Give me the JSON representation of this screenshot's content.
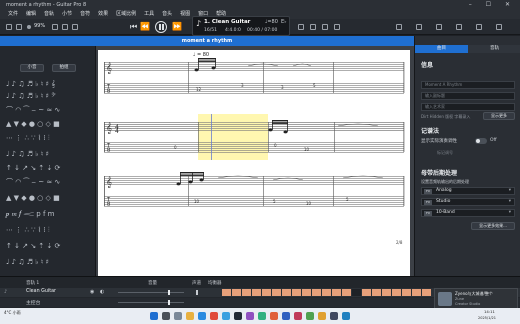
{
  "window": {
    "title": "moment a rhythm - Guitar Pro 8",
    "controls": "– ☐ ✕"
  },
  "menu": [
    "文件",
    "编辑",
    "音轨",
    "小节",
    "音符",
    "效果",
    "区域比例",
    "工具",
    "音头",
    "视图",
    "窗口",
    "帮助"
  ],
  "toolbar": {
    "zoom": "99%",
    "page_btn_left": "页视",
    "page_btn_right": "单视"
  },
  "lcd": {
    "track_name": "1. Clean Guitar",
    "position": "16/51",
    "signature": "4:4.0:0",
    "time": "00:40 / 07:00",
    "tempo": "♩=80",
    "key": "E♭"
  },
  "doc_tab": "moment a rhythm",
  "score": {
    "tempo_mark": "♩ = 80",
    "page_number": "2/8"
  },
  "right_panel": {
    "tabs": [
      "曲目",
      "音轨"
    ],
    "info_heading": "信息",
    "title_placeholder": "Moment A Rhythm",
    "subtitle_placeholder": "输入副标题",
    "artist_placeholder": "输入艺术家",
    "more_btn": "显示更多",
    "copyright_text": "Dirt Hidden    版权 字幕录入",
    "notation_heading": "记谱法",
    "notation_label": "显示实际演奏调性",
    "toggle_label": "Off",
    "notation_sub": "标记调号",
    "master_heading": "母带后期处理",
    "master_desc": "设置音频轨输出的后期处理",
    "effects": [
      {
        "tag": "FX",
        "name": "Analog"
      },
      {
        "tag": "FX",
        "name": "Studio"
      },
      {
        "tag": "FX",
        "name": "10-Band"
      }
    ],
    "show_more_effects": "显示更多效果..."
  },
  "left_panel": {
    "tab1": "小音",
    "tab2": "拍组"
  },
  "tracks": {
    "header_label": "音轨 1",
    "volume_label": "音量",
    "pan_label": "声道",
    "eq_label": "均衡器",
    "items": [
      {
        "name": "Clean Guitar"
      },
      {
        "name": "主控台"
      }
    ]
  },
  "notification": {
    "title": "Zyeno与大城谱/整个",
    "line2": "Zune",
    "line3": "Creator Studio"
  },
  "taskbar": {
    "weather": "4°C 小雨",
    "time": "14:11",
    "date": "2025/1/21"
  },
  "colors": {
    "accent": "#1f6fd1",
    "highlight": "#fff7b0",
    "pattern": "#e8a07a"
  }
}
